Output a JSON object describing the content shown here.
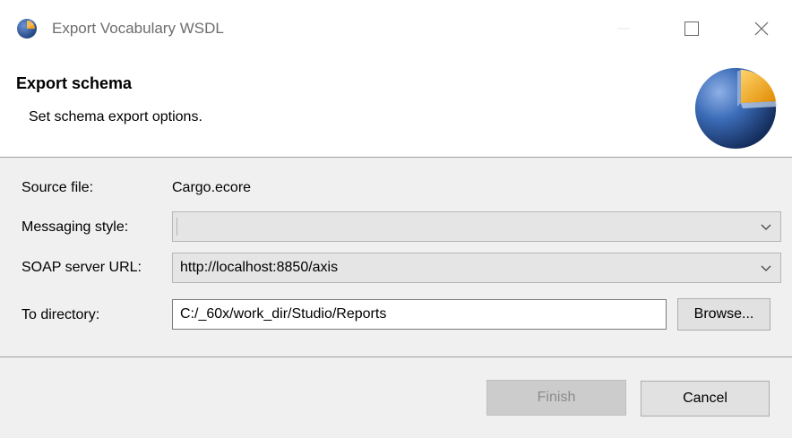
{
  "window": {
    "title": "Export Vocabulary WSDL"
  },
  "header": {
    "title": "Export schema",
    "description": "Set schema export options."
  },
  "form": {
    "source_file": {
      "label": "Source file:",
      "value": "Cargo.ecore"
    },
    "messaging_style": {
      "label": "Messaging style:",
      "value": ""
    },
    "soap_server_url": {
      "label": "SOAP server URL:",
      "value": "http://localhost:8850/axis"
    },
    "to_directory": {
      "label": "To directory:",
      "value": "C:/_60x/work_dir/Studio/Reports"
    },
    "browse_label": "Browse..."
  },
  "footer": {
    "finish_label": "Finish",
    "cancel_label": "Cancel"
  },
  "colors": {
    "logo_blue": "#2f5fa8",
    "logo_orange": "#f0a21a"
  },
  "icons": [
    "app-logo-icon",
    "minimize-icon",
    "maximize-icon",
    "close-icon",
    "wizard-banner-icon",
    "chevron-down-icon"
  ]
}
